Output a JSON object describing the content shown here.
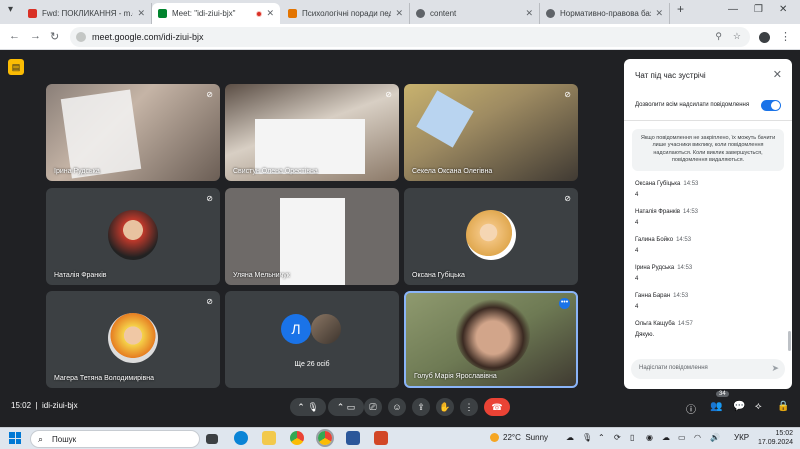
{
  "browser": {
    "tabs": [
      {
        "title": "Fwd: ПОКЛИКАННЯ - m.go",
        "active": false,
        "favicon_color": "#d93025"
      },
      {
        "title": "Meet: \"idi-ziui-bjx\"",
        "active": true,
        "favicon_color": "#00832d"
      },
      {
        "title": "Психологічні поради педа",
        "active": false,
        "favicon_color": "#e37400"
      },
      {
        "title": "content",
        "active": false,
        "favicon_color": "#5f6368"
      },
      {
        "title": "Нормативно-правова база",
        "active": false,
        "favicon_color": "#5f6368"
      }
    ],
    "new_tab": "+",
    "url": "meet.google.com/idi-ziui-bjx"
  },
  "meet": {
    "logo_icon": "captions-icon",
    "tiles": [
      {
        "name": "Ірина Рудська",
        "muted": true
      },
      {
        "name": "Свистун Олена Орестівна",
        "muted": true
      },
      {
        "name": "Секела Оксана Олегівна",
        "muted": true
      },
      {
        "name": "Наталія Франків",
        "muted": true,
        "avatar_color": "#c0392b"
      },
      {
        "name": "Уляна Мельничук",
        "muted": false
      },
      {
        "name": "Оксана Губіцька",
        "muted": true,
        "avatar_color": "#f1c27d"
      },
      {
        "name": "Магера Тетяна Володимирівна",
        "muted": true,
        "avatar_color": "#e67e22"
      },
      {
        "name": "Ще 26 осіб",
        "chip_letter": "Л",
        "chip_color": "#1a73e8"
      },
      {
        "name": "Голуб Марія Ярославівна",
        "muted": false
      }
    ],
    "more_dots": "•••",
    "meeting_time": "15:02",
    "meeting_code": "idi-ziui-bjx",
    "participants_badge": "34"
  },
  "chat": {
    "title": "Чат під час зустрічі",
    "allow_label": "Дозволити всім надсилати повідомлення",
    "notice": "Якщо повідомлення не закріплено, їх можуть бачити лише учасники виклику, коли повідомлення надсилаються. Коли виклик завершується, повідомлення видаляються.",
    "messages": [
      {
        "sender": "Оксана Губіцька",
        "time": "14:53",
        "text": "4"
      },
      {
        "sender": "Наталія Франків",
        "time": "14:53",
        "text": "4"
      },
      {
        "sender": "Галина Бойко",
        "time": "14:53",
        "text": "4"
      },
      {
        "sender": "Ірина Рудська",
        "time": "14:53",
        "text": "4"
      },
      {
        "sender": "Ганна Баран",
        "time": "14:53",
        "text": "4"
      },
      {
        "sender": "Ольга Кащуба",
        "time": "14:57",
        "text": "Дякую."
      }
    ],
    "input_placeholder": "Надіслати повідомлення"
  },
  "taskbar": {
    "search_label": "Пошук",
    "weather_temp": "22°C",
    "weather_text": "Sunny",
    "lang": "УКР",
    "time": "15:02",
    "date": "17.09.2024"
  }
}
